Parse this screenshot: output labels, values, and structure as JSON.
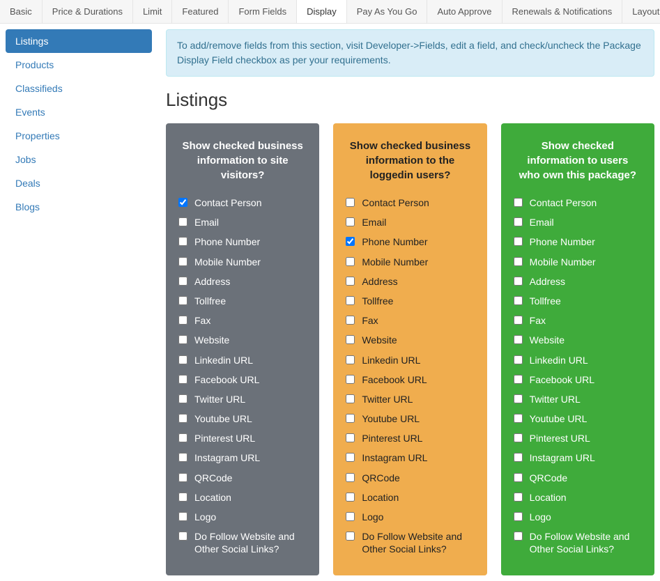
{
  "tabs": [
    "Basic",
    "Price & Durations",
    "Limit",
    "Featured",
    "Form Fields",
    "Display",
    "Pay As You Go",
    "Auto Approve",
    "Renewals & Notifications",
    "Layout"
  ],
  "active_tab": 5,
  "sidebar": [
    "Listings",
    "Products",
    "Classifieds",
    "Events",
    "Properties",
    "Jobs",
    "Deals",
    "Blogs"
  ],
  "active_sidebar": 0,
  "info_text": "To add/remove fields from this section, visit Developer->Fields, edit a field, and check/uncheck the Package Display Field checkbox as per your requirements.",
  "section_title": "Listings",
  "fields": [
    "Contact Person",
    "Email",
    "Phone Number",
    "Mobile Number",
    "Address",
    "Tollfree",
    "Fax",
    "Website",
    "Linkedin URL",
    "Facebook URL",
    "Twitter URL",
    "Youtube URL",
    "Pinterest URL",
    "Instagram URL",
    "QRCode",
    "Location",
    "Logo",
    "Do Follow Website and Other Social Links?"
  ],
  "panels": [
    {
      "color": "gray",
      "title": "Show checked business information to site visitors?",
      "checked": [
        0
      ]
    },
    {
      "color": "orange",
      "title": "Show checked business information to the loggedin users?",
      "checked": [
        2
      ]
    },
    {
      "color": "green",
      "title": "Show checked information to users who own this package?",
      "checked": []
    }
  ]
}
